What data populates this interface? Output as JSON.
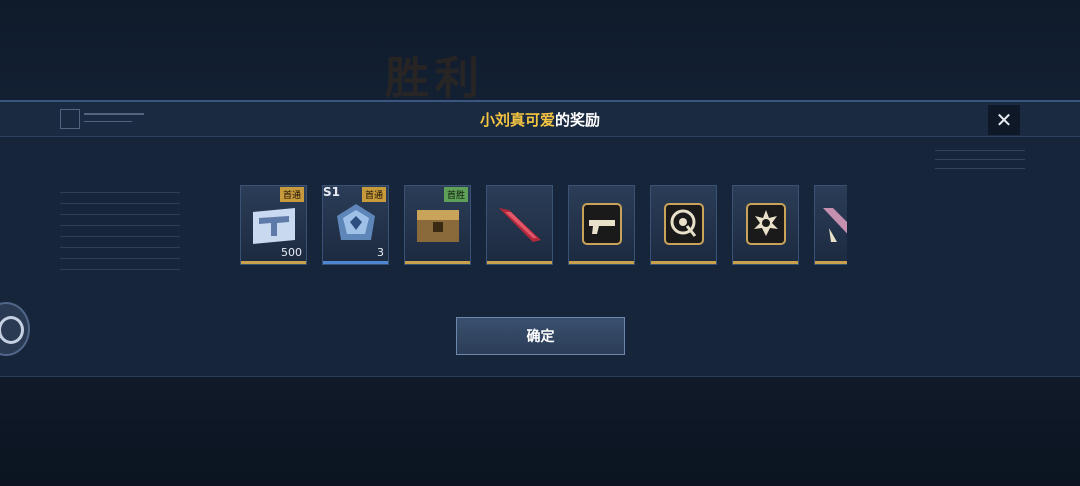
{
  "background": {
    "title": "胜利"
  },
  "dialog": {
    "title_name": "小刘真可爱",
    "title_suffix": "的奖励",
    "close_label": "✕",
    "confirm_label": "确定"
  },
  "items": [
    {
      "name": "ticket-card",
      "badge": "首通",
      "badge_color": "gold",
      "count": "500",
      "season": ""
    },
    {
      "name": "blue-crystal",
      "badge": "首通",
      "badge_color": "gold",
      "count": "3",
      "season": "S1"
    },
    {
      "name": "supply-crate",
      "badge": "首胜",
      "badge_color": "green",
      "count": "",
      "season": ""
    },
    {
      "name": "red-blade",
      "badge": "",
      "badge_color": "",
      "count": "",
      "season": ""
    },
    {
      "name": "gun-emblem",
      "badge": "",
      "badge_color": "",
      "count": "",
      "season": ""
    },
    {
      "name": "target-emblem",
      "badge": "",
      "badge_color": "",
      "count": "",
      "season": ""
    },
    {
      "name": "burst-emblem",
      "badge": "",
      "badge_color": "",
      "count": "",
      "season": ""
    },
    {
      "name": "pink-blade",
      "badge": "",
      "badge_color": "",
      "count": "",
      "season": ""
    }
  ],
  "colors": {
    "accent_gold": "#f5c542",
    "panel": "#17253a",
    "badge_gold": "#c79a3c",
    "badge_green": "#5fa058"
  }
}
